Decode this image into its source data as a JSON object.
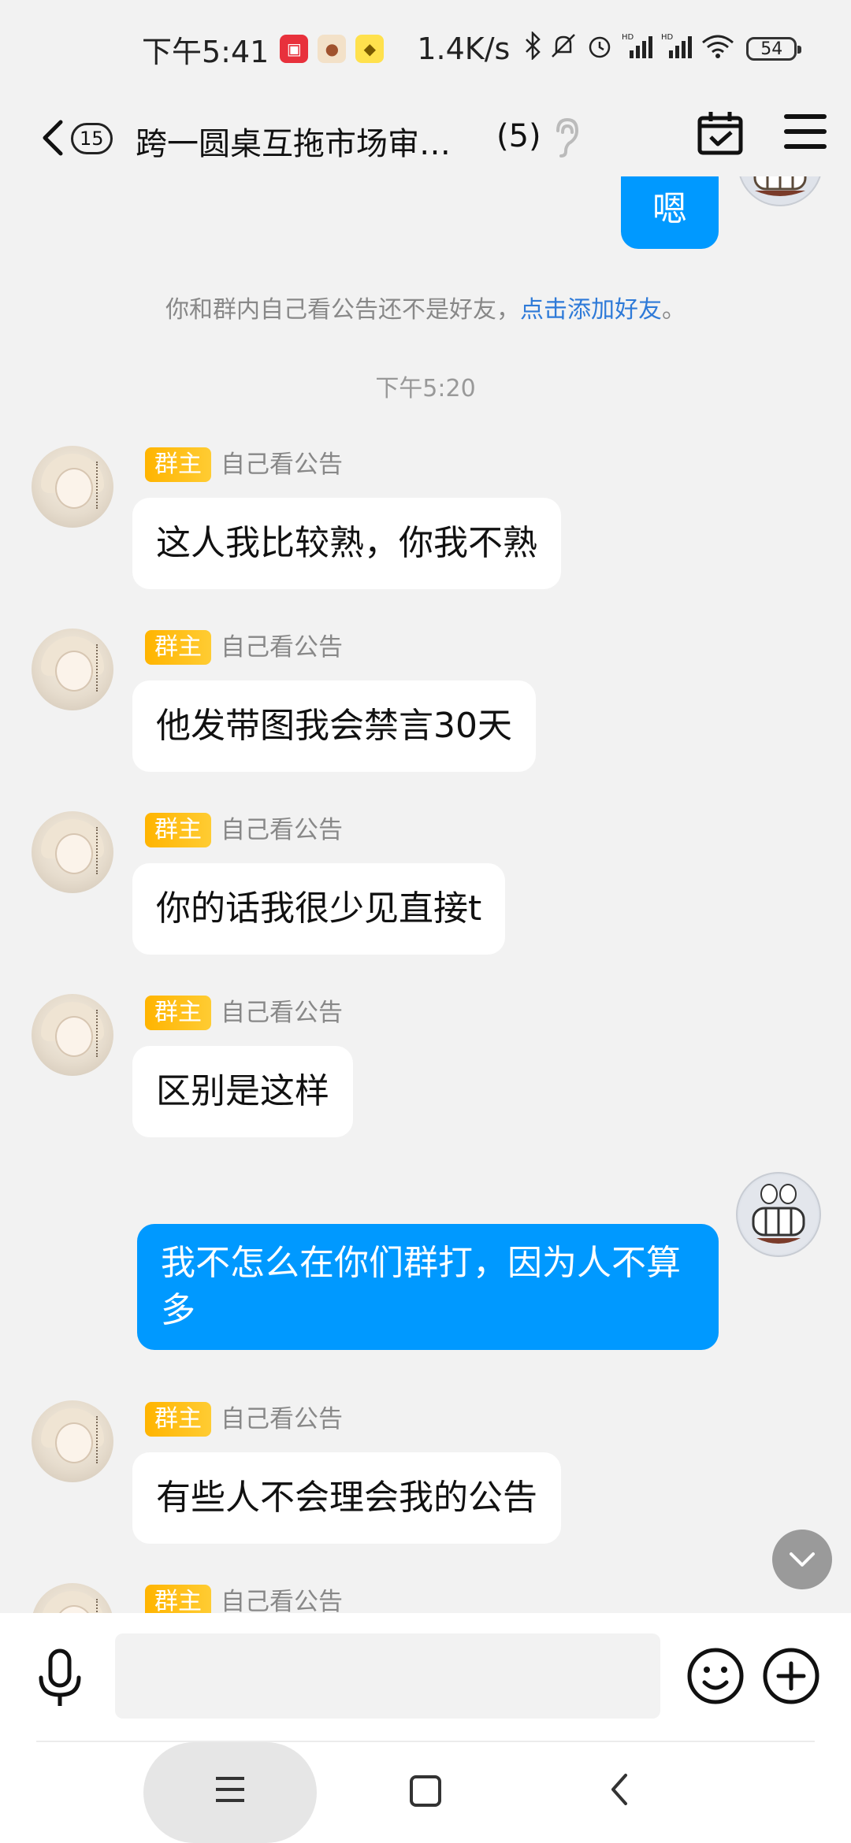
{
  "status_bar": {
    "time": "下午5:41",
    "speed": "1.4K/s",
    "battery": "54",
    "network_label": "HD"
  },
  "header": {
    "unread_count": "15",
    "title": "跨一圆桌互拖市场审…",
    "member_count": "(5)"
  },
  "messages": {
    "my_first": "嗯",
    "system_note_prefix": "你和群内自己看公告还不是好友，",
    "system_note_link": "点击添加好友",
    "system_note_suffix": "。",
    "timestamp": "下午5:20",
    "owner_tag": "群主",
    "sender_name": "自己看公告",
    "m1": "这人我比较熟，你我不熟",
    "m2": "他发带图我会禁言30天",
    "m3": "你的话我很少见直接t",
    "m4": "区别是这样",
    "my_second": "我不怎么在你们群打，因为人不算多",
    "m5": "有些人不会理会我的公告"
  },
  "colors": {
    "my_bubble": "#0099ff",
    "link": "#2e7ad8",
    "owner_tag": "#ffb400"
  }
}
